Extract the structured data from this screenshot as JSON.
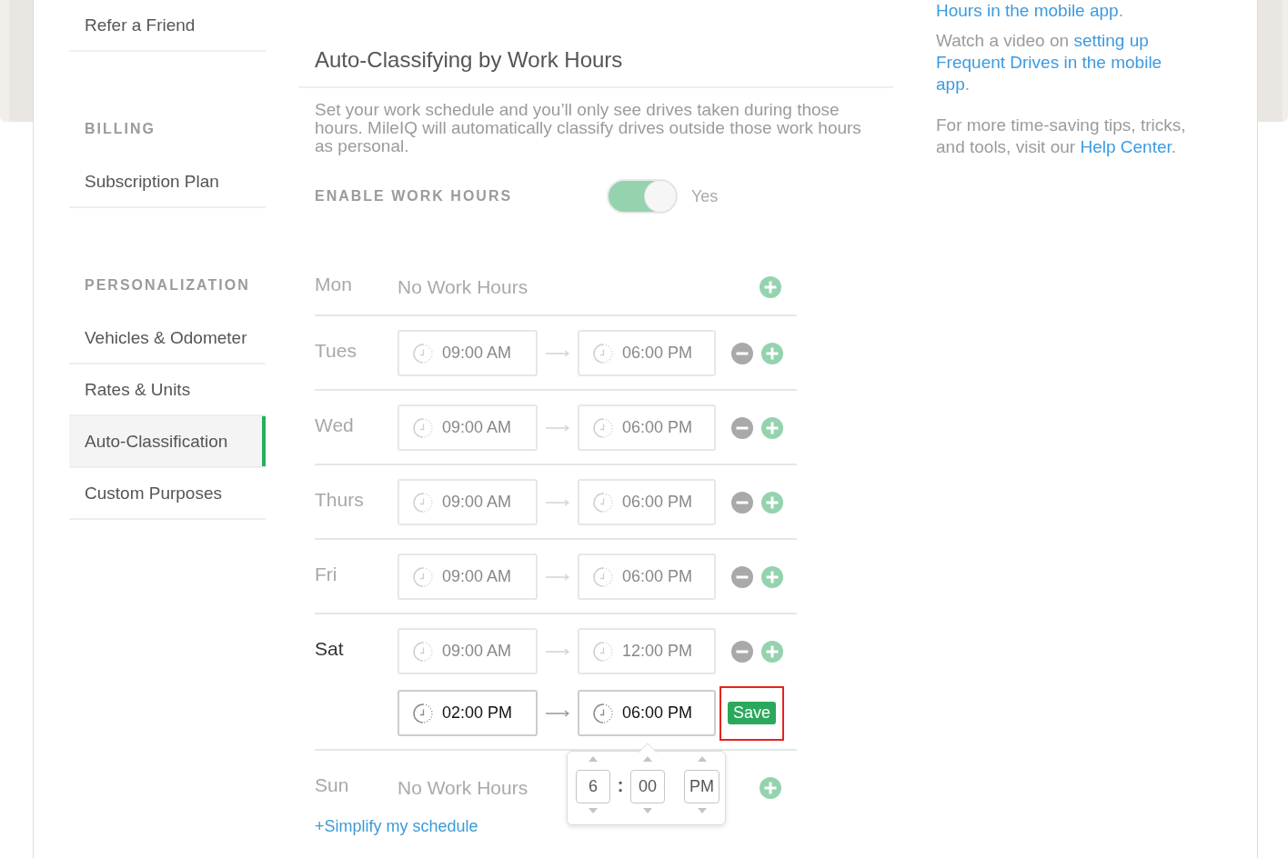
{
  "sidebar": {
    "sections": [
      {
        "items": [
          {
            "label": "Refer a Friend",
            "selected": false
          }
        ]
      },
      {
        "heading": "BILLING",
        "items": [
          {
            "label": "Subscription Plan",
            "selected": false
          }
        ]
      },
      {
        "heading": "PERSONALIZATION",
        "items": [
          {
            "label": "Vehicles & Odometer",
            "selected": false
          },
          {
            "label": "Rates & Units",
            "selected": false
          },
          {
            "label": "Auto-Classification",
            "selected": true
          },
          {
            "label": "Custom Purposes",
            "selected": false
          }
        ]
      }
    ]
  },
  "work_hours": {
    "title": "Auto-Classifying by Work Hours",
    "description": "Set your work schedule and you’ll only see drives taken during those hours. MileIQ will automatically classify drives outside those work hours as personal.",
    "enable_label": "ENABLE WORK HOURS",
    "on": true,
    "state_text": "Yes",
    "days": [
      {
        "day": "Mon",
        "kind": "off",
        "editing": false,
        "note": "No Work Hours"
      },
      {
        "day": "Tues",
        "kind": "hours",
        "editing": false,
        "slots": [
          {
            "from": "09:00 AM",
            "to": "06:00 PM",
            "editing": false,
            "highlighted": false
          }
        ]
      },
      {
        "day": "Wed",
        "kind": "hours",
        "editing": false,
        "slots": [
          {
            "from": "09:00 AM",
            "to": "06:00 PM",
            "editing": false,
            "highlighted": false
          }
        ]
      },
      {
        "day": "Thurs",
        "kind": "hours",
        "editing": false,
        "slots": [
          {
            "from": "09:00 AM",
            "to": "06:00 PM",
            "editing": false,
            "highlighted": false
          }
        ]
      },
      {
        "day": "Fri",
        "kind": "hours",
        "editing": false,
        "slots": [
          {
            "from": "09:00 AM",
            "to": "06:00 PM",
            "editing": false,
            "highlighted": false
          }
        ]
      },
      {
        "day": "Sat",
        "kind": "hours",
        "editing": true,
        "slots": [
          {
            "from": "09:00 AM",
            "to": "12:00 PM",
            "editing": false,
            "highlighted": false
          },
          {
            "from": "02:00 PM",
            "to": "06:00 PM",
            "editing": true,
            "highlighted": true,
            "save_label": "Save",
            "picker": {
              "hour": "6",
              "separator": ":",
              "minute": "00",
              "period": "PM"
            }
          }
        ]
      },
      {
        "day": "Sun",
        "kind": "off",
        "editing": false,
        "note": "No Work Hours"
      }
    ],
    "simplify_link": "+Simplify my schedule"
  },
  "help": {
    "paragraphs": [
      {
        "parts": [
          {
            "kind": "link",
            "lines": [
              "Hours in the mobile app"
            ]
          },
          {
            "kind": "text",
            "text": "."
          }
        ]
      },
      {
        "parts": [
          {
            "kind": "text",
            "text": "Watch a video on "
          },
          {
            "kind": "link",
            "lines": [
              "setting up",
              "Frequent Drives in the mobile",
              "app"
            ]
          },
          {
            "kind": "text",
            "text": "."
          }
        ]
      },
      {
        "parts": [
          {
            "kind": "text",
            "text": "For more time-saving tips, tricks, and tools, visit our "
          },
          {
            "kind": "link",
            "lines": [
              "Help Center"
            ]
          },
          {
            "kind": "text",
            "text": "."
          }
        ]
      }
    ]
  }
}
